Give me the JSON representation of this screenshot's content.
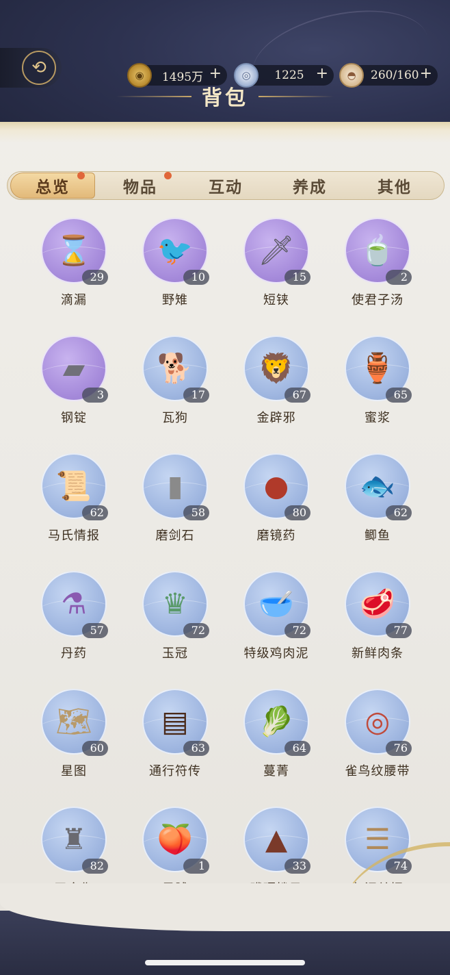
{
  "header": {
    "title": "背包",
    "back_label": "⟲",
    "currencies": [
      {
        "icon": "coin-icon",
        "value": "1495万",
        "plus": "+"
      },
      {
        "icon": "jade-icon",
        "value": "1225",
        "plus": "+"
      },
      {
        "icon": "bowl-icon",
        "value": "260/160",
        "plus": "+"
      }
    ]
  },
  "tabs": [
    {
      "label": "总览",
      "active": true,
      "badge": true
    },
    {
      "label": "物品",
      "active": false,
      "badge": true
    },
    {
      "label": "互动",
      "active": false,
      "badge": false
    },
    {
      "label": "养成",
      "active": false,
      "badge": false
    },
    {
      "label": "其他",
      "active": false,
      "badge": false
    }
  ],
  "items": [
    {
      "name": "滴漏",
      "count": "29",
      "bg": "purple",
      "icon": "water-clock-icon",
      "glyph": "⌛",
      "color": "#8a6a2a"
    },
    {
      "name": "野雉",
      "count": "10",
      "bg": "purple",
      "icon": "pheasant-icon",
      "glyph": "🐦",
      "color": "#7a4a22"
    },
    {
      "name": "短铗",
      "count": "15",
      "bg": "purple",
      "icon": "short-sword-icon",
      "glyph": "🗡",
      "color": "#5a5a60"
    },
    {
      "name": "使君子汤",
      "count": "2",
      "bg": "purple",
      "icon": "soup-bowl-icon",
      "glyph": "🍵",
      "color": "#7a2e24"
    },
    {
      "name": "钢锭",
      "count": "3",
      "bg": "purple",
      "icon": "steel-ingot-icon",
      "glyph": "▰",
      "color": "#707078"
    },
    {
      "name": "瓦狗",
      "count": "17",
      "bg": "blue",
      "icon": "clay-dog-icon",
      "glyph": "🐕",
      "color": "#8a5a3a"
    },
    {
      "name": "金辟邪",
      "count": "67",
      "bg": "blue",
      "icon": "golden-beast-icon",
      "glyph": "🦁",
      "color": "#b8902a"
    },
    {
      "name": "蜜浆",
      "count": "65",
      "bg": "blue",
      "icon": "honey-jar-icon",
      "glyph": "🏺",
      "color": "#c9a14a"
    },
    {
      "name": "马氏情报",
      "count": "62",
      "bg": "blue",
      "icon": "scroll-bundle-icon",
      "glyph": "📜",
      "color": "#9a6a3a"
    },
    {
      "name": "磨剑石",
      "count": "58",
      "bg": "blue",
      "icon": "whetstone-icon",
      "glyph": "▮",
      "color": "#8a8a8a"
    },
    {
      "name": "磨镜药",
      "count": "80",
      "bg": "blue",
      "icon": "red-paste-icon",
      "glyph": "●",
      "color": "#b03a2a"
    },
    {
      "name": "鲫鱼",
      "count": "62",
      "bg": "blue",
      "icon": "fish-stew-icon",
      "glyph": "🐟",
      "color": "#5a6a6a"
    },
    {
      "name": "丹药",
      "count": "57",
      "bg": "blue",
      "icon": "potion-bottle-icon",
      "glyph": "⚗",
      "color": "#8a5ab0"
    },
    {
      "name": "玉冠",
      "count": "72",
      "bg": "blue",
      "icon": "jade-crown-icon",
      "glyph": "♛",
      "color": "#5a9a6a"
    },
    {
      "name": "特级鸡肉泥",
      "count": "72",
      "bg": "blue",
      "icon": "meat-bowl-icon",
      "glyph": "🥣",
      "color": "#d07a5a"
    },
    {
      "name": "新鲜肉条",
      "count": "77",
      "bg": "blue",
      "icon": "meat-strips-icon",
      "glyph": "🥩",
      "color": "#b04a4a"
    },
    {
      "name": "星图",
      "count": "60",
      "bg": "blue",
      "icon": "star-map-icon",
      "glyph": "🗺",
      "color": "#b89a6a"
    },
    {
      "name": "通行符传",
      "count": "63",
      "bg": "blue",
      "icon": "pass-token-icon",
      "glyph": "▤",
      "color": "#4a2a1a"
    },
    {
      "name": "蔓菁",
      "count": "64",
      "bg": "blue",
      "icon": "turnip-icon",
      "glyph": "🥬",
      "color": "#6a9a4a"
    },
    {
      "name": "雀鸟纹腰带",
      "count": "76",
      "bg": "blue",
      "icon": "belt-icon",
      "glyph": "◎",
      "color": "#c04a3a"
    },
    {
      "name": "司命像",
      "count": "82",
      "bg": "blue",
      "icon": "statue-icon",
      "glyph": "♜",
      "color": "#6a6a70"
    },
    {
      "name": "果脯",
      "count": "1",
      "bg": "blue",
      "icon": "dried-fruit-icon",
      "glyph": "🍑",
      "color": "#d08a3a"
    },
    {
      "name": "玳瑁拨子",
      "count": "33",
      "bg": "blue",
      "icon": "plectrum-icon",
      "glyph": "▲",
      "color": "#7a3a2a"
    },
    {
      "name": "归汗单据",
      "count": "74",
      "bg": "blue",
      "icon": "bamboo-slips-icon",
      "glyph": "☰",
      "color": "#b08a5a"
    }
  ]
}
